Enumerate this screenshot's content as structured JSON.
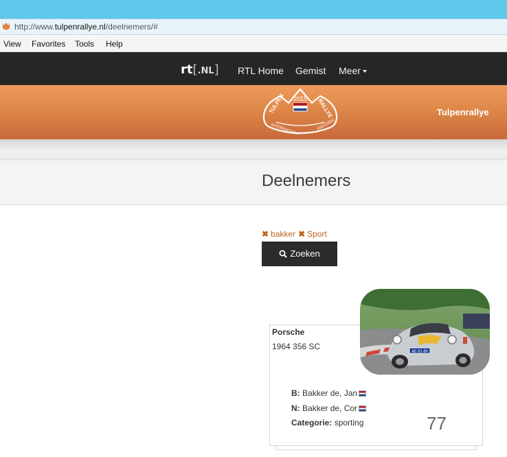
{
  "browser": {
    "url_prefix": "http://www.",
    "url_domain": "tulpenrallye.nl",
    "url_path": "/deelnemers/#",
    "menu": [
      "View",
      "Favorites",
      "Tools",
      "Help"
    ]
  },
  "rtl_nav": {
    "logo_text": "rt",
    "logo_nl": ".NL",
    "items": [
      "RTL Home",
      "Gemist",
      "Meer"
    ]
  },
  "header": {
    "logo_text": {
      "top": "TULPEN",
      "year": "2015",
      "right": "RALLYE",
      "bottom_left": "INTERNATIONAL",
      "bottom_right": "HISTORIC"
    },
    "site_title": "Tulpenrallye"
  },
  "page": {
    "title": "Deelnemers",
    "filters": [
      "bakker",
      "Sport"
    ],
    "search_label": "Zoeken"
  },
  "participant": {
    "make": "Porsche",
    "model": "1964 356 SC",
    "driver_label": "B:",
    "driver": "Bakker de, Jan",
    "navigator_label": "N:",
    "navigator": "Bakker de, Cor",
    "category_label": "Categorie:",
    "category": "sporting",
    "number": "77",
    "plate": "AE-91-89"
  },
  "colors": {
    "accent": "#c0621a",
    "header_orange": "#e08a4a",
    "nav_dark": "#262626",
    "browser_blue": "#5fc8ea"
  }
}
